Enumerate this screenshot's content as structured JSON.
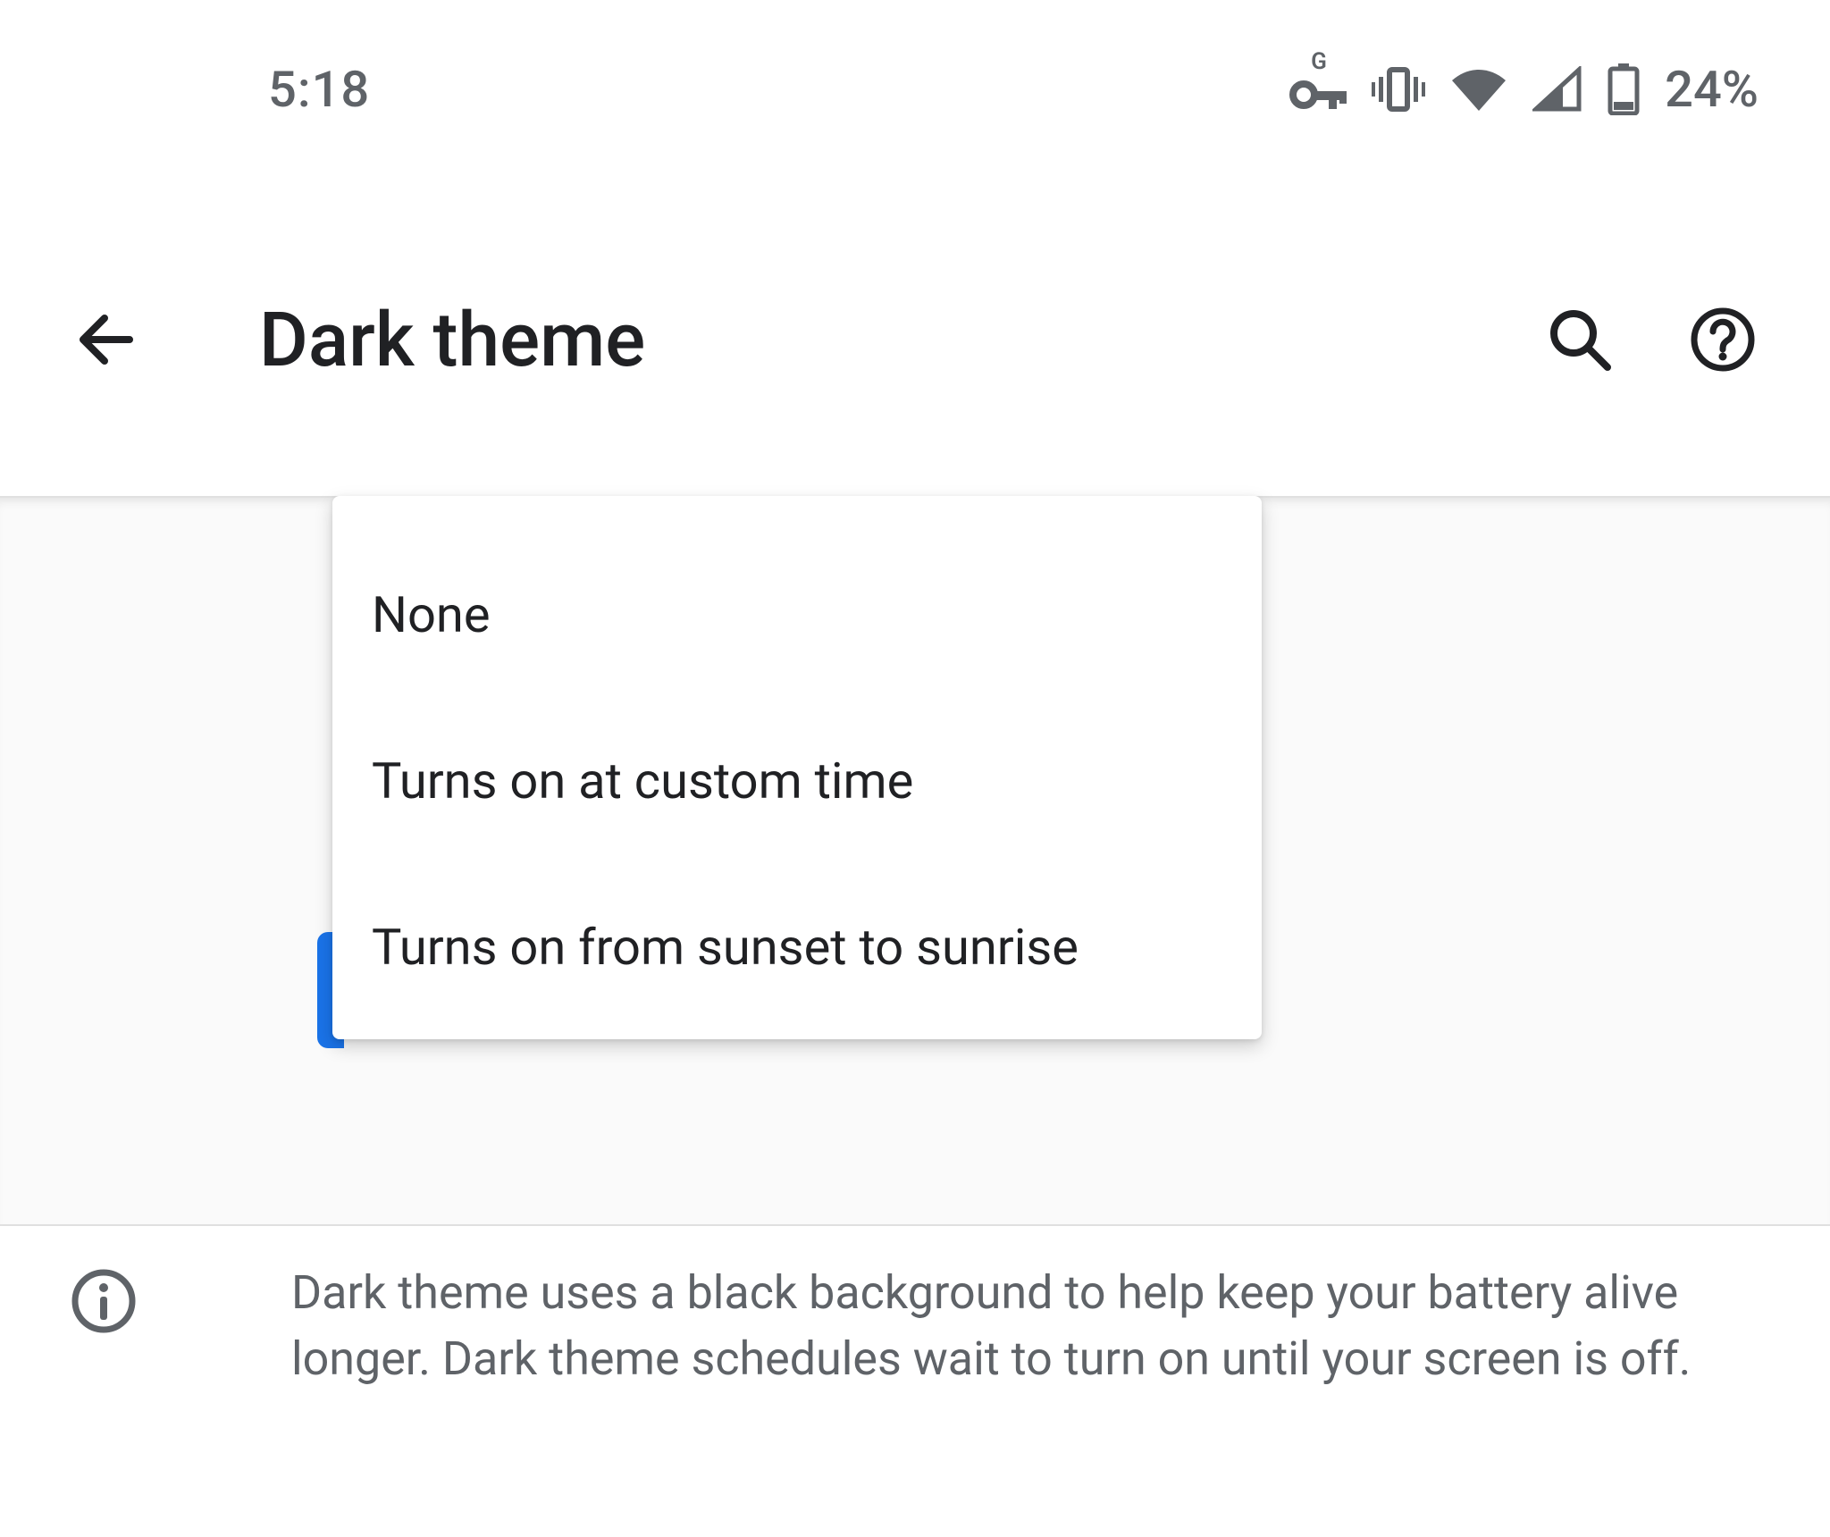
{
  "statusbar": {
    "time": "5:18",
    "battery_text": "24%",
    "icons": {
      "vpn": "vpn-key-icon",
      "network_badge": "G",
      "vibrate": "vibrate-icon",
      "wifi": "wifi-icon",
      "cell": "cell-signal-icon",
      "battery": "battery-outline-icon"
    }
  },
  "appbar": {
    "title": "Dark theme",
    "back": "back-icon",
    "search": "search-icon",
    "help": "help-icon"
  },
  "menu": {
    "items": [
      {
        "label": "None"
      },
      {
        "label": "Turns on at custom time"
      },
      {
        "label": "Turns on from sunset to sunrise"
      }
    ]
  },
  "info": {
    "text": "Dark theme uses a black background to help keep your battery alive longer. Dark theme schedules wait to turn on until your screen is off."
  }
}
